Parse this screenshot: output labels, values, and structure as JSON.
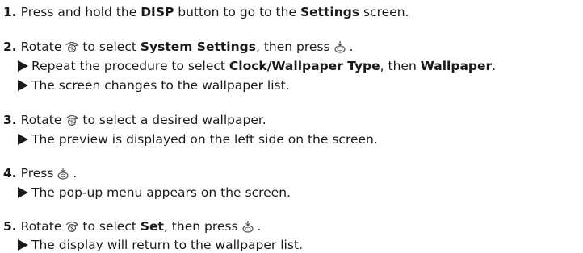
{
  "steps": [
    {
      "num": "1.",
      "parts": [
        {
          "t": "Press and hold the "
        },
        {
          "b": "DISP"
        },
        {
          "t": " button to go to the "
        },
        {
          "b": "Settings"
        },
        {
          "t": " screen."
        }
      ],
      "subs": []
    },
    {
      "num": "2.",
      "parts": [
        {
          "t": "Rotate"
        },
        {
          "icon": "dial-icon"
        },
        {
          "t": "to select "
        },
        {
          "b": "System Settings"
        },
        {
          "t": ", then press"
        },
        {
          "icon": "press-icon"
        },
        {
          "t": "."
        }
      ],
      "subs": [
        [
          {
            "t": "Repeat the procedure to select "
          },
          {
            "b": "Clock/Wallpaper Type"
          },
          {
            "t": ", then "
          },
          {
            "b": "Wallpaper"
          },
          {
            "t": "."
          }
        ],
        [
          {
            "t": "The screen changes to the wallpaper list."
          }
        ]
      ]
    },
    {
      "num": "3.",
      "parts": [
        {
          "t": "Rotate"
        },
        {
          "icon": "dial-icon"
        },
        {
          "t": "to select a desired wallpaper."
        }
      ],
      "subs": [
        [
          {
            "t": "The preview is displayed on the left side on the screen."
          }
        ]
      ]
    },
    {
      "num": "4.",
      "parts": [
        {
          "t": "Press"
        },
        {
          "icon": "press-icon"
        },
        {
          "t": "."
        }
      ],
      "subs": [
        [
          {
            "t": "The pop-up menu appears on the screen."
          }
        ]
      ]
    },
    {
      "num": "5.",
      "parts": [
        {
          "t": "Rotate"
        },
        {
          "icon": "dial-icon"
        },
        {
          "t": "to select "
        },
        {
          "b": "Set"
        },
        {
          "t": ", then press"
        },
        {
          "icon": "press-icon"
        },
        {
          "t": "."
        }
      ],
      "subs": [
        [
          {
            "t": "The display will return to the wallpaper list."
          }
        ]
      ]
    }
  ]
}
